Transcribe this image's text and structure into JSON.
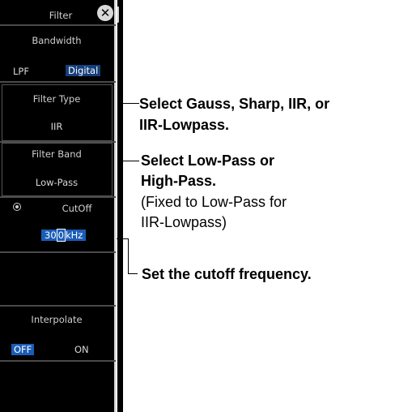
{
  "panel": {
    "title": "Filter",
    "bandwidth_label": "Bandwidth",
    "lpf_label": "LPF",
    "lpf_value": "Digital",
    "filter_type_label": "Filter Type",
    "filter_type_value": "IIR",
    "filter_band_label": "Filter Band",
    "filter_band_value": "Low-Pass",
    "cutoff_label": "CutOff",
    "cutoff_value_prefix": "30",
    "cutoff_value_cursor": "0",
    "cutoff_value_unit": "kHz",
    "interpolate_label": "Interpolate",
    "interpolate_off": "OFF",
    "interpolate_on": "ON"
  },
  "annotations": {
    "filter_type_line1": "Select Gauss, Sharp, IIR, or",
    "filter_type_line2": "IIR-Lowpass.",
    "filter_band_line1": "Select Low-Pass or",
    "filter_band_line2": "High-Pass.",
    "filter_band_note1": "(Fixed to Low-Pass for",
    "filter_band_note2": "IIR-Lowpass)",
    "cutoff_text": "Set the cutoff frequency."
  },
  "icons": {
    "close": "close-icon",
    "radio": "radio-icon"
  }
}
